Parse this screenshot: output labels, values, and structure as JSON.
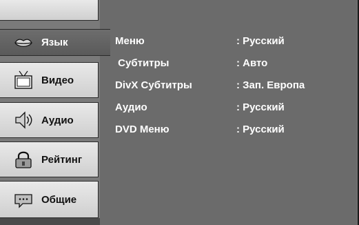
{
  "sidebar": {
    "tabs": [
      {
        "label": "Язык",
        "icon": "lips-icon",
        "active": true
      },
      {
        "label": "Видео",
        "icon": "tv-icon",
        "active": false
      },
      {
        "label": "Аудио",
        "icon": "speaker-icon",
        "active": false
      },
      {
        "label": "Рейтинг",
        "icon": "lock-icon",
        "active": false
      },
      {
        "label": "Общие",
        "icon": "speech-bubble-icon",
        "active": false
      }
    ]
  },
  "menu": {
    "rows": [
      {
        "name": "Меню",
        "value": ": Русский"
      },
      {
        "name": " Субтитры",
        "value": ": Авто"
      },
      {
        "name": "DivX Субтитры",
        "value": ": Зап. Европа"
      },
      {
        "name": "Аудио",
        "value": ": Русский"
      },
      {
        "name": "DVD Меню",
        "value": ": Русский"
      }
    ]
  },
  "colors": {
    "panel": "#6b6b6b",
    "tab": "#e0e0e0",
    "text_active": "#ffffff"
  }
}
